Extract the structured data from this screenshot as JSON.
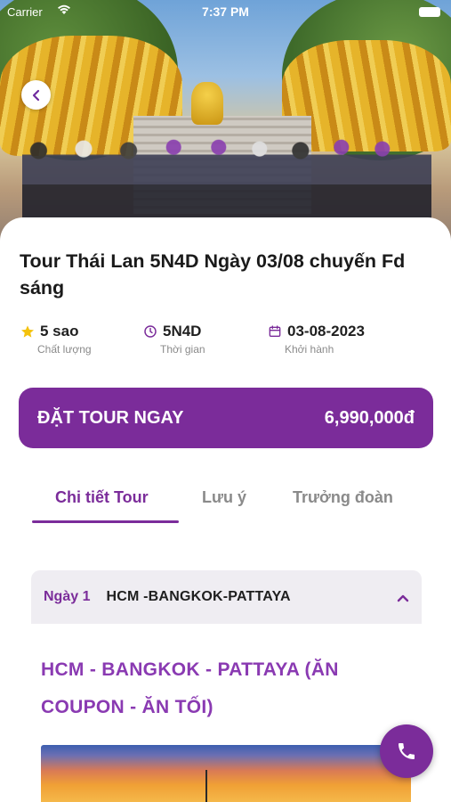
{
  "status_bar": {
    "carrier": "Carrier",
    "time": "7:37 PM"
  },
  "tour": {
    "title": "Tour Thái Lan 5N4D Ngày 03/08 chuyến Fd sáng",
    "quality_value": "5 sao",
    "quality_label": "Chất lượng",
    "duration_value": "5N4D",
    "duration_label": "Thời gian",
    "departure_value": "03-08-2023",
    "departure_label": "Khởi hành"
  },
  "booking": {
    "button_label": "ĐẶT TOUR NGAY",
    "price": "6,990,000đ"
  },
  "tabs": [
    {
      "label": "Chi tiết Tour",
      "active": true
    },
    {
      "label": "Lưu ý",
      "active": false
    },
    {
      "label": "Trưởng đoàn",
      "active": false
    }
  ],
  "itinerary": {
    "day_label": "Ngày 1",
    "day_route": "HCM -BANGKOK-PATTAYA",
    "day_title": "HCM - BANGKOK - PATTAYA (ĂN COUPON - ĂN TỐI)"
  },
  "colors": {
    "accent": "#7b2c9a",
    "star": "#f4c20d"
  },
  "icons": {
    "back": "chevron-left-icon",
    "star": "star-icon",
    "clock": "clock-icon",
    "calendar": "calendar-icon",
    "chevron_up": "chevron-up-icon",
    "phone": "phone-icon"
  }
}
